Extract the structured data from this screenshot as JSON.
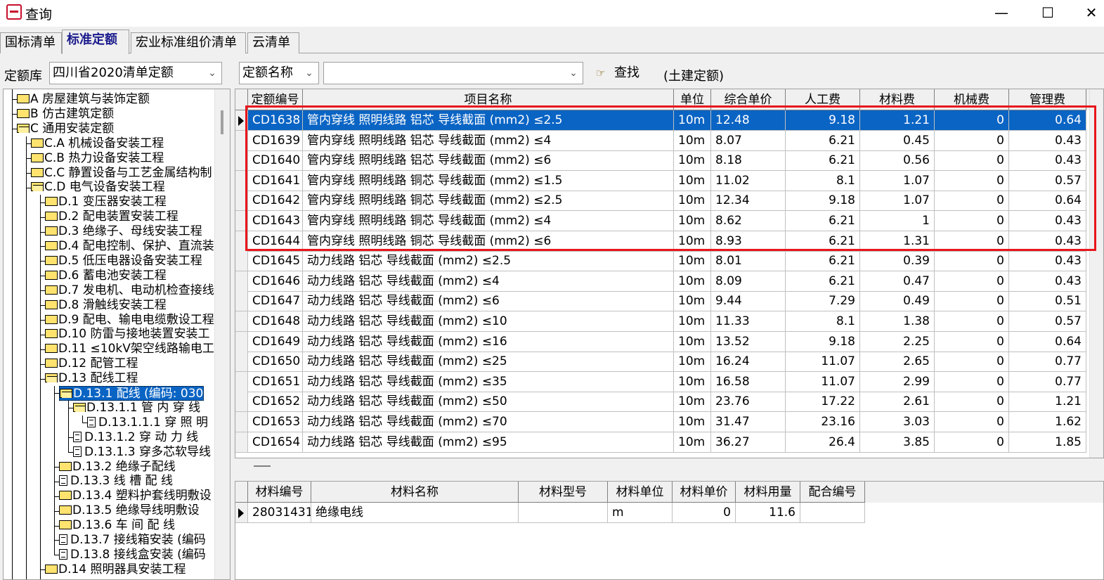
{
  "window": {
    "title": "查询",
    "minimize": "—",
    "maximize": "☐",
    "close": "✕"
  },
  "tabs": [
    "国标清单",
    "标准定额",
    "宏业标准组价清单",
    "云清单"
  ],
  "search": {
    "library_label": "定额库",
    "library_value": "四川省2020清单定额",
    "field_value": "定额名称",
    "query_value": "",
    "find_label": "查找",
    "scope_note": "(土建定额)"
  },
  "tree": [
    {
      "label": "A 房屋建筑与装饰定额",
      "icon": "folder"
    },
    {
      "label": "B 仿古建筑定额",
      "icon": "folder"
    },
    {
      "label": "C 通用安装定额",
      "icon": "folder-open"
    },
    {
      "label": "C.A 机械设备安装工程",
      "icon": "folder"
    },
    {
      "label": "C.B 热力设备安装工程",
      "icon": "folder"
    },
    {
      "label": "C.C 静置设备与工艺金属结构制",
      "icon": "folder"
    },
    {
      "label": "C.D 电气设备安装工程",
      "icon": "folder-open"
    },
    {
      "label": "D.1 变压器安装工程",
      "icon": "folder"
    },
    {
      "label": "D.2 配电装置安装工程",
      "icon": "folder"
    },
    {
      "label": "D.3 绝缘子、母线安装工程",
      "icon": "folder"
    },
    {
      "label": "D.4 配电控制、保护、直流装",
      "icon": "folder"
    },
    {
      "label": "D.5 低压电器设备安装工程",
      "icon": "folder"
    },
    {
      "label": "D.6 蓄电池安装工程",
      "icon": "folder"
    },
    {
      "label": "D.7 发电机、电动机检查接线",
      "icon": "folder"
    },
    {
      "label": "D.8 滑触线安装工程",
      "icon": "folder"
    },
    {
      "label": "D.9 配电、输电电缆敷设工程",
      "icon": "folder"
    },
    {
      "label": "D.10 防雷与接地装置安装工",
      "icon": "folder"
    },
    {
      "label": "D.11 ≤10kV架空线路输电工",
      "icon": "folder"
    },
    {
      "label": "D.12 配管工程",
      "icon": "folder"
    },
    {
      "label": "D.13 配线工程",
      "icon": "folder-open"
    },
    {
      "label": "D.13.1 配线 (编码: 030",
      "icon": "folder-open"
    },
    {
      "label": "D.13.1.1 管 内 穿 线",
      "icon": "folder-open"
    },
    {
      "label": "D.13.1.1.1 穿 照 明",
      "icon": "doc"
    },
    {
      "label": "D.13.1.2 穿 动 力 线",
      "icon": "doc"
    },
    {
      "label": "D.13.1.3 穿多芯软导线",
      "icon": "doc"
    },
    {
      "label": "D.13.2 绝缘子配线",
      "icon": "folder"
    },
    {
      "label": "D.13.3 线 槽 配 线",
      "icon": "doc"
    },
    {
      "label": "D.13.4 塑料护套线明敷设",
      "icon": "folder"
    },
    {
      "label": "D.13.5 绝缘导线明敷设",
      "icon": "folder"
    },
    {
      "label": "D.13.6 车 间 配 线",
      "icon": "folder"
    },
    {
      "label": "D.13.7 接线箱安装 (编码",
      "icon": "doc"
    },
    {
      "label": "D.13.8 接线盒安装 (编码",
      "icon": "doc"
    },
    {
      "label": "D.14 照明器具安装工程",
      "icon": "folder"
    }
  ],
  "quota_table": {
    "headers": [
      "定额编号",
      "项目名称",
      "单位",
      "综合单价",
      "人工费",
      "材料费",
      "机械费",
      "管理费"
    ],
    "rows": [
      [
        "CD1638",
        "管内穿线 照明线路 铝芯 导线截面 (mm2) ≤2.5",
        "10m",
        "12.48",
        "9.18",
        "1.21",
        "0",
        "0.64"
      ],
      [
        "CD1639",
        "管内穿线 照明线路 铝芯 导线截面 (mm2) ≤4",
        "10m",
        "8.07",
        "6.21",
        "0.45",
        "0",
        "0.43"
      ],
      [
        "CD1640",
        "管内穿线 照明线路 铝芯 导线截面 (mm2) ≤6",
        "10m",
        "8.18",
        "6.21",
        "0.56",
        "0",
        "0.43"
      ],
      [
        "CD1641",
        "管内穿线 照明线路 铜芯 导线截面 (mm2) ≤1.5",
        "10m",
        "11.02",
        "8.1",
        "1.07",
        "0",
        "0.57"
      ],
      [
        "CD1642",
        "管内穿线 照明线路 铜芯 导线截面 (mm2) ≤2.5",
        "10m",
        "12.34",
        "9.18",
        "1.07",
        "0",
        "0.64"
      ],
      [
        "CD1643",
        "管内穿线 照明线路 铜芯 导线截面 (mm2) ≤4",
        "10m",
        "8.62",
        "6.21",
        "1",
        "0",
        "0.43"
      ],
      [
        "CD1644",
        "管内穿线 照明线路 铜芯 导线截面 (mm2) ≤6",
        "10m",
        "8.93",
        "6.21",
        "1.31",
        "0",
        "0.43"
      ],
      [
        "CD1645",
        "动力线路 铝芯 导线截面 (mm2) ≤2.5",
        "10m",
        "8.01",
        "6.21",
        "0.39",
        "0",
        "0.43"
      ],
      [
        "CD1646",
        "动力线路 铝芯 导线截面 (mm2) ≤4",
        "10m",
        "8.09",
        "6.21",
        "0.47",
        "0",
        "0.43"
      ],
      [
        "CD1647",
        "动力线路 铝芯 导线截面 (mm2) ≤6",
        "10m",
        "9.44",
        "7.29",
        "0.49",
        "0",
        "0.51"
      ],
      [
        "CD1648",
        "动力线路 铝芯 导线截面 (mm2) ≤10",
        "10m",
        "11.33",
        "8.1",
        "1.38",
        "0",
        "0.57"
      ],
      [
        "CD1649",
        "动力线路 铝芯 导线截面 (mm2) ≤16",
        "10m",
        "13.52",
        "9.18",
        "2.25",
        "0",
        "0.64"
      ],
      [
        "CD1650",
        "动力线路 铝芯 导线截面 (mm2) ≤25",
        "10m",
        "16.24",
        "11.07",
        "2.65",
        "0",
        "0.77"
      ],
      [
        "CD1651",
        "动力线路 铝芯 导线截面 (mm2) ≤35",
        "10m",
        "16.58",
        "11.07",
        "2.99",
        "0",
        "0.77"
      ],
      [
        "CD1652",
        "动力线路 铝芯 导线截面 (mm2) ≤50",
        "10m",
        "23.76",
        "17.22",
        "2.61",
        "0",
        "1.21"
      ],
      [
        "CD1653",
        "动力线路 铝芯 导线截面 (mm2) ≤70",
        "10m",
        "31.47",
        "23.16",
        "3.03",
        "0",
        "1.62"
      ],
      [
        "CD1654",
        "动力线路 铝芯 导线截面 (mm2) ≤95",
        "10m",
        "36.27",
        "26.4",
        "3.85",
        "0",
        "1.85"
      ]
    ]
  },
  "material_table": {
    "headers": [
      "材料编号",
      "材料名称",
      "材料型号",
      "材料单位",
      "材料单价",
      "材料用量",
      "配合编号"
    ],
    "rows": [
      [
        "28031431",
        "绝缘电线",
        "",
        "m",
        "0",
        "11.6",
        ""
      ]
    ]
  },
  "colors": {
    "selection": "#0a64c4",
    "highlight_box": "#e8161b",
    "active_tab_text": "#1b1b8c"
  }
}
